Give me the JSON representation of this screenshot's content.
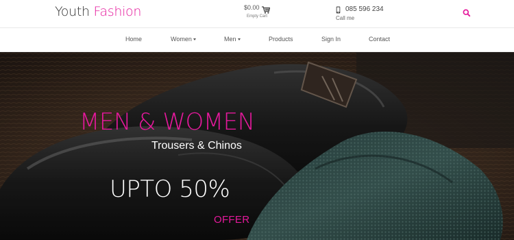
{
  "brand": {
    "part1": "Youth",
    "part2": "Fashion"
  },
  "cart": {
    "price": "$0.00",
    "status": "Empty Cart"
  },
  "contact": {
    "phone": "085 596 234",
    "label": "Call me"
  },
  "nav": {
    "items": [
      {
        "label": "Home"
      },
      {
        "label": "Women"
      },
      {
        "label": "Men"
      },
      {
        "label": "Products"
      },
      {
        "label": "Sign In"
      },
      {
        "label": "Contact"
      }
    ]
  },
  "hero": {
    "headline": "MEN & WOMEN",
    "subheadline": "Trousers & Chinos",
    "promo": "UPTO 50%",
    "offer": "OFFER"
  },
  "colors": {
    "accent": "#e5199c",
    "text": "#333333",
    "hero_bg": "#2c221b"
  },
  "icons": {
    "cart": "shopping-cart-icon",
    "phone": "mobile-phone-icon",
    "search": "search-icon"
  }
}
